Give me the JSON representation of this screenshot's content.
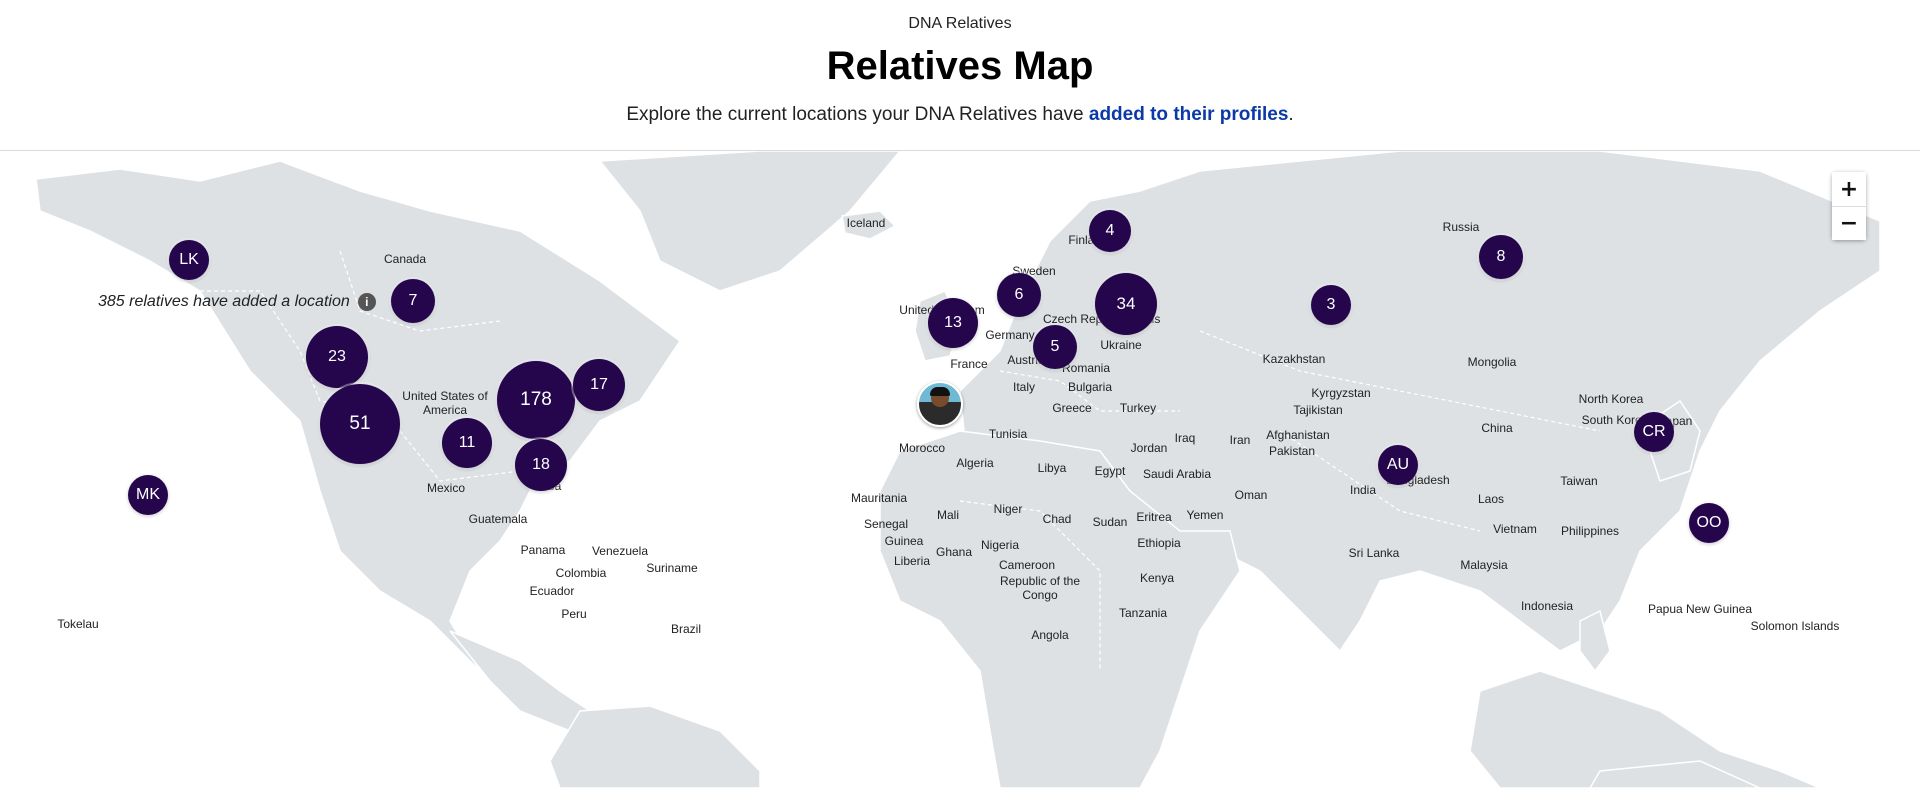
{
  "header": {
    "eyebrow": "DNA Relatives",
    "title": "Relatives Map",
    "subtitle_prefix": "Explore the current locations your DNA Relatives have ",
    "subtitle_link": "added to their profiles",
    "subtitle_suffix": "."
  },
  "map": {
    "location_count_text": "385 relatives have added a location",
    "zoom_in_label": "+",
    "zoom_out_label": "−",
    "land_color": "#dde1e4",
    "cluster_color": "#25064c",
    "clusters": [
      {
        "label": "LK",
        "kind": "initials"
      },
      {
        "label": "7",
        "kind": "count"
      },
      {
        "label": "23",
        "kind": "count"
      },
      {
        "label": "51",
        "kind": "count"
      },
      {
        "label": "11",
        "kind": "count"
      },
      {
        "label": "178",
        "kind": "count"
      },
      {
        "label": "17",
        "kind": "count"
      },
      {
        "label": "18",
        "kind": "count"
      },
      {
        "label": "MK",
        "kind": "initials"
      },
      {
        "label": "13",
        "kind": "count"
      },
      {
        "label": "6",
        "kind": "count"
      },
      {
        "label": "4",
        "kind": "count"
      },
      {
        "label": "34",
        "kind": "count"
      },
      {
        "label": "5",
        "kind": "count"
      },
      {
        "label": "3",
        "kind": "count"
      },
      {
        "label": "8",
        "kind": "count"
      },
      {
        "label": "AU",
        "kind": "initials"
      },
      {
        "label": "CR",
        "kind": "initials"
      },
      {
        "label": "OO",
        "kind": "initials"
      }
    ],
    "country_labels": [
      "Canada",
      "United States of America",
      "Mexico",
      "Guatemala",
      "Cuba",
      "Panama",
      "Venezuela",
      "Colombia",
      "Suriname",
      "Ecuador",
      "Peru",
      "Brazil",
      "Tokelau",
      "Iceland",
      "United Kingdom",
      "Sweden",
      "Finland",
      "Germany",
      "France",
      "Austria",
      "Italy",
      "Romania",
      "Bulgaria",
      "Greece",
      "Turkey",
      "Ukraine",
      "Czech Republic",
      "Belarus",
      "Russia",
      "Kazakhstan",
      "Mongolia",
      "Kyrgyzstan",
      "Tajikistan",
      "Afghanistan",
      "Iraq",
      "Iran",
      "Jordan",
      "Pakistan",
      "Saudi Arabia",
      "Egypt",
      "Libya",
      "Tunisia",
      "Morocco",
      "Algeria",
      "Mauritania",
      "Mali",
      "Niger",
      "Chad",
      "Sudan",
      "Eritrea",
      "Yemen",
      "Oman",
      "Ethiopia",
      "Senegal",
      "Guinea",
      "Ghana",
      "Nigeria",
      "Liberia",
      "Cameroon",
      "Republic of the Congo",
      "Kenya",
      "Tanzania",
      "Angola",
      "India",
      "Bangladesh",
      "Sri Lanka",
      "China",
      "North Korea",
      "South Korea",
      "Japan",
      "Taiwan",
      "Laos",
      "Vietnam",
      "Philippines",
      "Malaysia",
      "Indonesia",
      "Papua New Guinea",
      "Solomon Islands"
    ]
  }
}
